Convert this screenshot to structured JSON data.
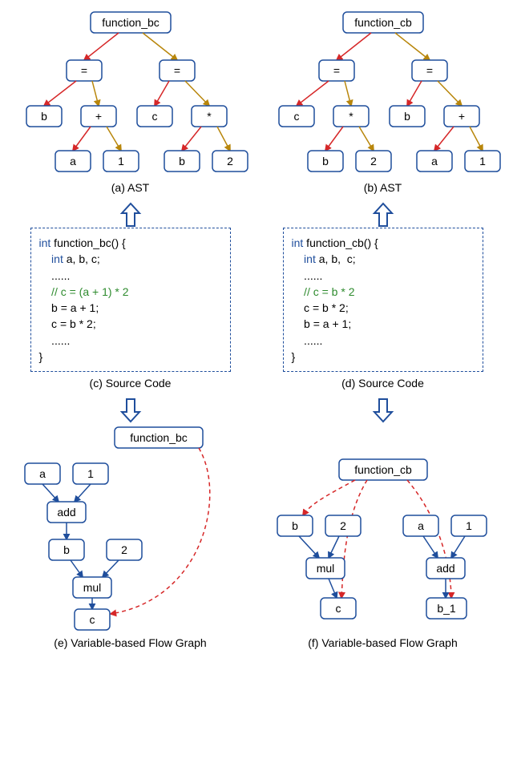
{
  "ast_a": {
    "root": "function_bc",
    "eq1_left": "b",
    "eq1_op": "+",
    "eq1_a": "a",
    "eq1_b": "1",
    "eq2_left": "c",
    "eq2_op": "*",
    "eq2_a": "b",
    "eq2_b": "2",
    "caption": "(a) AST"
  },
  "ast_b": {
    "root": "function_cb",
    "eq1_left": "c",
    "eq1_op": "*",
    "eq1_a": "b",
    "eq1_b": "2",
    "eq2_left": "b",
    "eq2_op": "+",
    "eq2_a": "a",
    "eq2_b": "1",
    "caption": "(b) AST"
  },
  "code_c": {
    "sig_kw": "int",
    "sig_rest": " function_bc() {",
    "decl_kw": "    int",
    "decl_rest": " a, b, c;",
    "dots": "    ......",
    "comment": "    // c = (a + 1) * 2",
    "s1": "    b = a + 1;",
    "s2": "    c = b * 2;",
    "close": "}",
    "caption": "(c) Source Code"
  },
  "code_d": {
    "sig_kw": "int",
    "sig_rest": " function_cb() {",
    "decl_kw": "    int",
    "decl_rest": " a, b,  c;",
    "dots": "    ......",
    "comment": "    // c = b * 2",
    "s1": "    c = b * 2;",
    "s2": "    b = a + 1;",
    "close": "}",
    "caption": "(d) Source Code"
  },
  "vfg_e": {
    "root": "function_bc",
    "a": "a",
    "one": "1",
    "add": "add",
    "b": "b",
    "two": "2",
    "mul": "mul",
    "c": "c",
    "caption": "(e) Variable-based Flow Graph"
  },
  "vfg_f": {
    "root": "function_cb",
    "b": "b",
    "two": "2",
    "mul": "mul",
    "c": "c",
    "a": "a",
    "one": "1",
    "add": "add",
    "b1": "b_1",
    "caption": "(f) Variable-based Flow Graph"
  },
  "icons": {
    "eq": "="
  }
}
